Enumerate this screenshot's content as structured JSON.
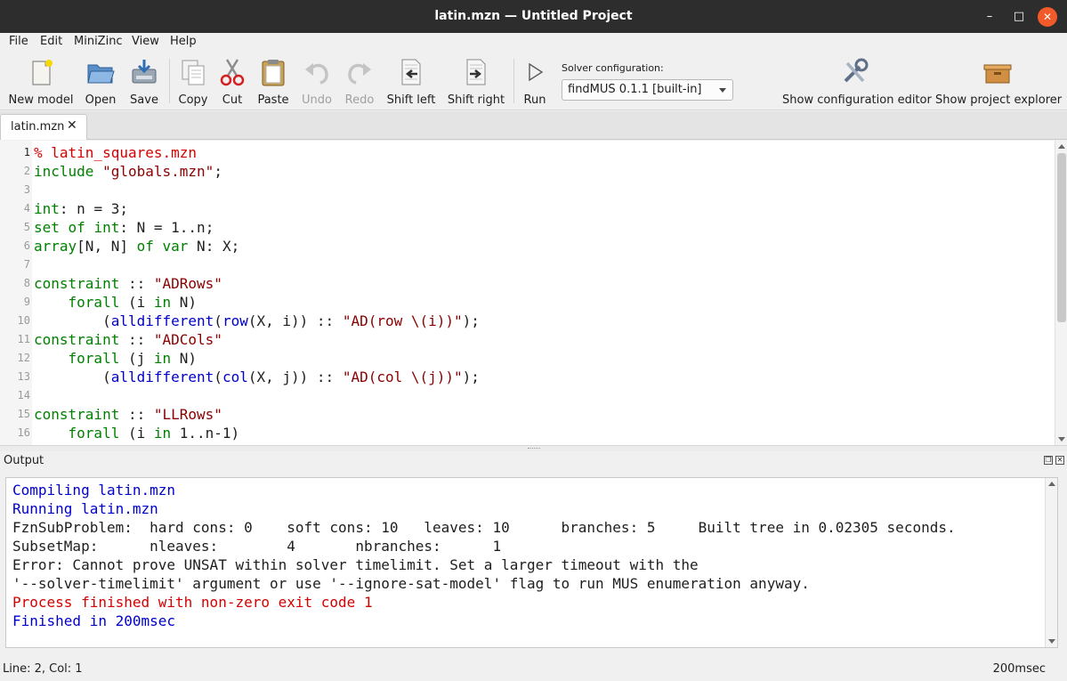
{
  "window": {
    "title": "latin.mzn — Untitled Project",
    "minimize_glyph": "–",
    "maximize_glyph": "□",
    "close_glyph": "✕"
  },
  "menu": {
    "items": [
      {
        "label": "File",
        "mnemonic": "F"
      },
      {
        "label": "Edit"
      },
      {
        "label": "MiniZinc"
      },
      {
        "label": "View"
      },
      {
        "label": "Help"
      }
    ]
  },
  "toolbar": {
    "buttons": [
      {
        "label": "New model",
        "icon": "new-model-icon",
        "enabled": true
      },
      {
        "label": "Open",
        "icon": "folder-open-icon",
        "enabled": true
      },
      {
        "label": "Save",
        "icon": "save-icon",
        "enabled": true
      },
      {
        "label": "Copy",
        "icon": "copy-icon",
        "enabled": true
      },
      {
        "label": "Cut",
        "icon": "scissors-icon",
        "enabled": true
      },
      {
        "label": "Paste",
        "icon": "clipboard-icon",
        "enabled": true
      },
      {
        "label": "Undo",
        "icon": "undo-icon",
        "enabled": false
      },
      {
        "label": "Redo",
        "icon": "redo-icon",
        "enabled": false
      },
      {
        "label": "Shift left",
        "icon": "shift-left-icon",
        "enabled": true
      },
      {
        "label": "Shift right",
        "icon": "shift-right-icon",
        "enabled": true
      },
      {
        "label": "Run",
        "icon": "play-icon",
        "enabled": true
      },
      {
        "label": "Show configuration editor",
        "icon": "tools-icon",
        "enabled": true
      },
      {
        "label": "Show project explorer",
        "icon": "box-icon",
        "enabled": true
      }
    ],
    "solver_label": "Solver configuration:",
    "solver_value": "findMUS 0.1.1 [built-in]"
  },
  "tabs": [
    {
      "label": "latin.mzn",
      "close_glyph": "✕",
      "active": true
    }
  ],
  "editor": {
    "current_line": 1,
    "line_numbers": [
      "1",
      "2",
      "3",
      "4",
      "5",
      "6",
      "7",
      "8",
      "9",
      "10",
      "11",
      "12",
      "13",
      "14",
      "15",
      "16"
    ],
    "lines": [
      "% latin_squares.mzn",
      "include \"globals.mzn\";",
      "",
      "int: n = 3;",
      "set of int: N = 1..n;",
      "array[N, N] of var N: X;",
      "",
      "constraint :: \"ADRows\"",
      "    forall (i in N)",
      "        (alldifferent(row(X, i)) :: \"AD(row \\(i))\");",
      "constraint :: \"ADCols\"",
      "    forall (j in N)",
      "        (alldifferent(col(X, j)) :: \"AD(col \\(j))\");",
      "",
      "constraint :: \"LLRows\"",
      "    forall (i in 1..n-1)"
    ]
  },
  "output": {
    "title": "Output",
    "lines": [
      {
        "text": "Compiling latin.mzn",
        "style": "blue"
      },
      {
        "text": "Running latin.mzn",
        "style": "blue"
      },
      {
        "text": "FznSubProblem:  hard cons: 0    soft cons: 10   leaves: 10      branches: 5     Built tree in 0.02305 seconds.",
        "style": "plain"
      },
      {
        "text": "SubsetMap:      nleaves:        4       nbranches:      1",
        "style": "plain"
      },
      {
        "text": "Error: Cannot prove UNSAT within solver timelimit. Set a larger timeout with the",
        "style": "plain"
      },
      {
        "text": "'--solver-timelimit' argument or use '--ignore-sat-model' flag to run MUS enumeration anyway.",
        "style": "plain"
      },
      {
        "text": "Process finished with non-zero exit code 1",
        "style": "red"
      },
      {
        "text": "Finished in 200msec",
        "style": "blue"
      }
    ]
  },
  "status": {
    "position": "Line: 2, Col: 1",
    "time": "200msec"
  },
  "colors": {
    "keyword": "#008000",
    "function": "#0000cd",
    "string": "#8b0000",
    "comment": "#d50000",
    "output_info": "#0000cd",
    "output_error": "#d50000",
    "titlebar": "#2d2d2d",
    "close_button": "#f25a29"
  }
}
